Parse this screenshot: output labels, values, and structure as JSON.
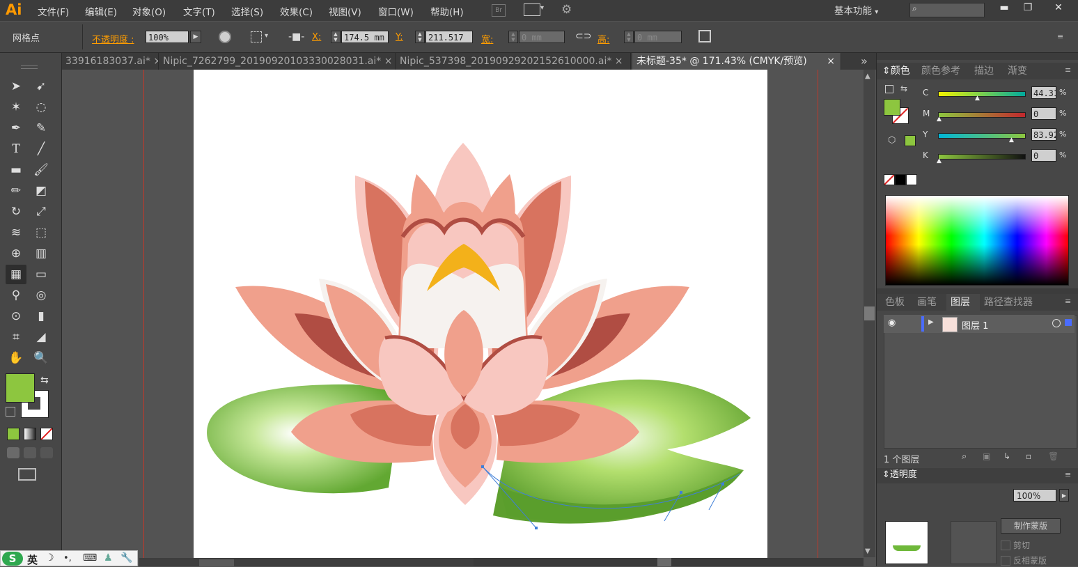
{
  "app": {
    "logo": "Ai"
  },
  "menu": [
    "文件(F)",
    "编辑(E)",
    "对象(O)",
    "文字(T)",
    "选择(S)",
    "效果(C)",
    "视图(V)",
    "窗口(W)",
    "帮助(H)"
  ],
  "workspace": {
    "label": "基本功能",
    "chevron": "▾"
  },
  "window_controls": {
    "minimize": "▬",
    "restore": "❐",
    "close": "✕"
  },
  "control_bar": {
    "selection_label": "网格点",
    "opacity_label": "不透明度 :",
    "opacity_value": "100%",
    "x_label": "X:",
    "x_value": "174.5 mm",
    "y_label": "Y:",
    "y_value": "211.517 r",
    "w_label": "宽:",
    "w_value": "0 mm",
    "h_label": "高:",
    "h_value": "0 mm"
  },
  "tabs": [
    {
      "label": "33916183037.ai*",
      "close": "×"
    },
    {
      "label": "Nipic_7262799_20190920103330028031.ai*",
      "close": "×"
    },
    {
      "label": "Nipic_537398_20190929202152610000.ai*",
      "close": "×"
    },
    {
      "label": "未标题-35* @ 171.43% (CMYK/预览)",
      "close": "×",
      "active": true
    }
  ],
  "tabs_overflow": "»",
  "color_panel": {
    "tabs": [
      "颜色",
      "颜色参考",
      "描边",
      "渐变"
    ],
    "channels": [
      {
        "name": "C",
        "value": "44.31",
        "fraction": 0.4431
      },
      {
        "name": "M",
        "value": "0",
        "fraction": 0
      },
      {
        "name": "Y",
        "value": "83.92",
        "fraction": 0.8392
      },
      {
        "name": "K",
        "value": "0",
        "fraction": 0
      }
    ],
    "percent": "%",
    "fill_color": "#8dc63f"
  },
  "layers_panel": {
    "tabs": [
      "色板",
      "画笔",
      "图层",
      "路径查找器"
    ],
    "layers": [
      {
        "name": "图层 1"
      }
    ],
    "count": "1 个图层"
  },
  "transparency_panel": {
    "title": "透明度",
    "value": "100%",
    "button": "制作蒙版",
    "options": [
      "剪切",
      "反相蒙版"
    ]
  },
  "ime": {
    "logo": "S",
    "lang": "英"
  },
  "canvas": {
    "colors": {
      "accent_orange": "#ff9a00",
      "petal_light": "#f8c7c0",
      "petal_mid": "#f0a08c",
      "petal_dark": "#d8735f",
      "petal_darkest": "#b04d43",
      "petal_white": "#f6f2ef",
      "gold": "#f3b11a",
      "leaf_green": "#8fcf4a",
      "leaf_dark": "#5a9e2c"
    }
  }
}
